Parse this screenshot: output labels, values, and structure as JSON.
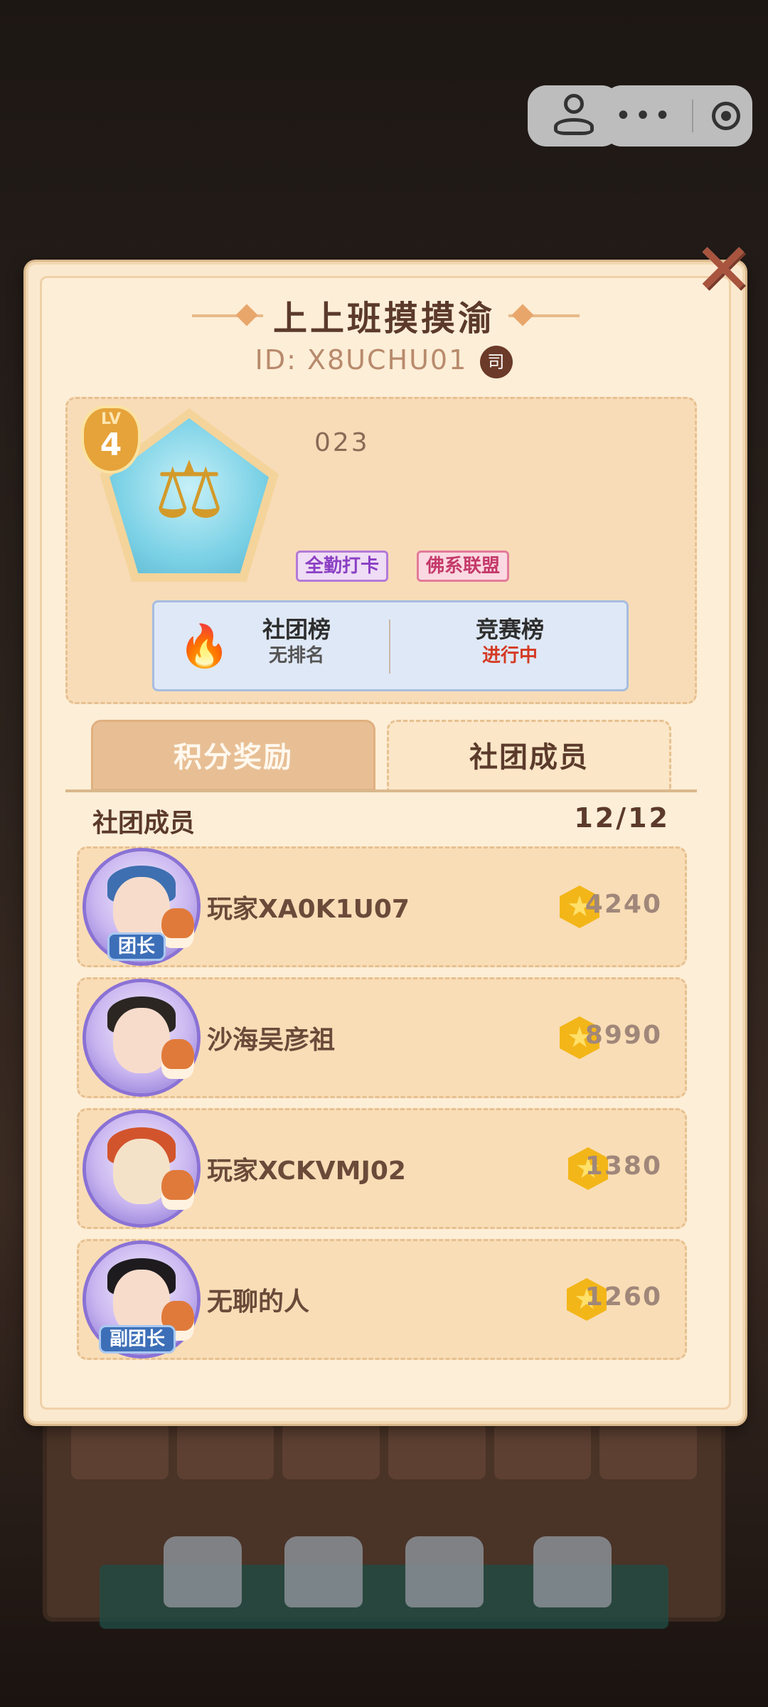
{
  "top_controls": {
    "more_label": "•••"
  },
  "club": {
    "name": "上上班摸摸渝",
    "id_text": "ID: X8UCHU01",
    "copy_label": "司",
    "level_prefix": "LV",
    "level": "4",
    "member_tally": "023",
    "tags": [
      "全勤打卡",
      "佛系联盟"
    ]
  },
  "rankings": [
    {
      "name": "社团榜",
      "value": "无排名"
    },
    {
      "name": "竞赛榜",
      "value": "进行中"
    }
  ],
  "tabs": {
    "points": "积分奖励",
    "members": "社团成员"
  },
  "member_list": {
    "header": "社团成员",
    "count": "12/12",
    "members": [
      {
        "name": "玩家XA0K1U07",
        "score": "4240",
        "role": "团长"
      },
      {
        "name": "沙海吴彦祖",
        "score": "8990",
        "role": ""
      },
      {
        "name": "玩家XCKVMJ02",
        "score": "1380",
        "role": ""
      },
      {
        "name": "无聊的人",
        "score": "1260",
        "role": "副团长"
      }
    ]
  },
  "colors": {
    "panel_bg": "#fdeed7",
    "accent_brown": "#5b3a2b",
    "coin": "#f3b619",
    "rank_active": "#d43a24"
  }
}
